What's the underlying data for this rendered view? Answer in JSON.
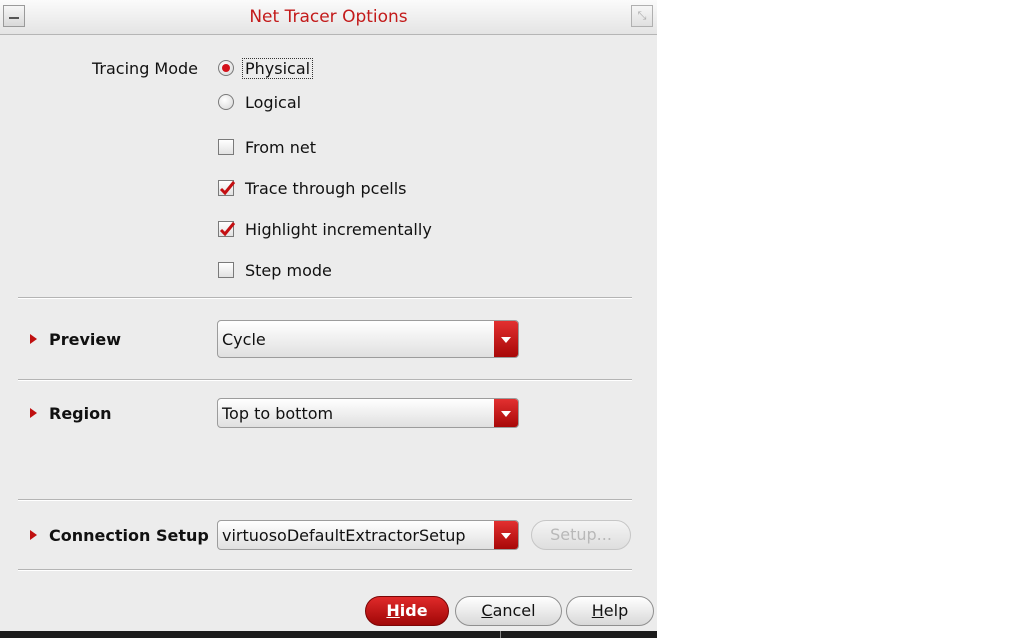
{
  "window": {
    "title": "Net Tracer Options"
  },
  "tracing": {
    "label": "Tracing Mode",
    "options": [
      {
        "label": "Physical",
        "selected": true
      },
      {
        "label": "Logical",
        "selected": false
      }
    ]
  },
  "checkboxes": [
    {
      "label": "From net",
      "checked": false
    },
    {
      "label": "Trace through pcells",
      "checked": true
    },
    {
      "label": "Highlight incrementally",
      "checked": true
    },
    {
      "label": "Step mode",
      "checked": false
    }
  ],
  "preview": {
    "label": "Preview",
    "value": "Cycle"
  },
  "region": {
    "label": "Region",
    "value": "Top to bottom"
  },
  "connection": {
    "label": "Connection Setup",
    "value": "virtuosoDefaultExtractorSetup",
    "setup_button": "Setup..."
  },
  "buttons": {
    "hide": {
      "mnemonic": "H",
      "rest": "ide"
    },
    "cancel": {
      "mnemonic": "C",
      "rest": "ancel"
    },
    "help": {
      "mnemonic": "H",
      "rest": "elp"
    }
  },
  "colors": {
    "accent": "#c31a1a",
    "dialog_bg": "#ececec"
  }
}
